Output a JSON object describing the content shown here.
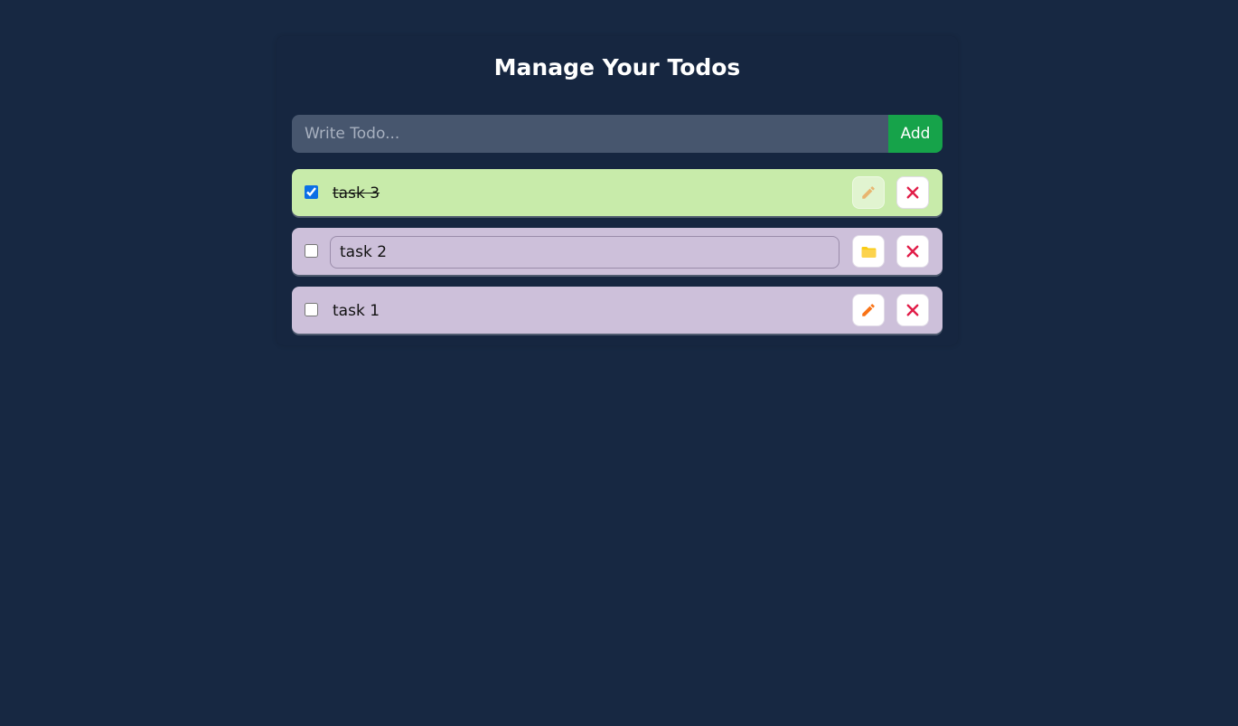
{
  "app": {
    "title": "Manage Your Todos"
  },
  "form": {
    "placeholder": "Write Todo...",
    "value": "",
    "add_label": "Add"
  },
  "todos": [
    {
      "text": "task 3",
      "completed": true,
      "editing": false
    },
    {
      "text": "task 2",
      "completed": false,
      "editing": true
    },
    {
      "text": "task 1",
      "completed": false,
      "editing": false
    }
  ],
  "icons": {
    "edit": "pencil-icon",
    "save": "folder-icon",
    "delete": "close-icon"
  },
  "colors": {
    "background": "#172842",
    "add_button": "#16a34a",
    "completed_row": "#c8ebaa",
    "open_row": "#cdc0da",
    "delete_icon": "#e11d48",
    "edit_icon": "#f97316",
    "save_icon": "#facc15"
  }
}
